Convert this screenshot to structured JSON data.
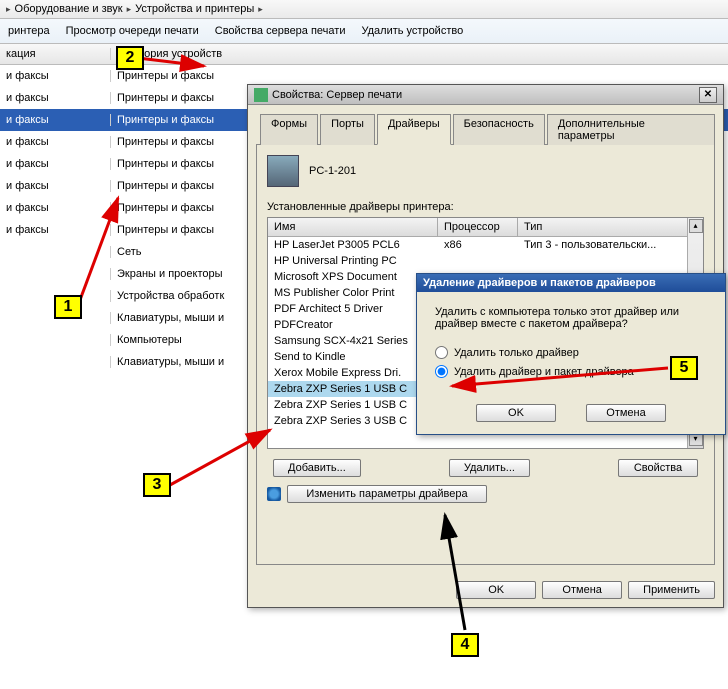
{
  "breadcrumb": {
    "item1": "Оборудование и звук",
    "item2": "Устройства и принтеры"
  },
  "toolbar": {
    "item1": "ринтера",
    "item2": "Просмотр очереди печати",
    "item3": "Свойства сервера печати",
    "item4": "Удалить устройство"
  },
  "columns": {
    "a": "кация",
    "b": "Категория устройств"
  },
  "rows": [
    {
      "a": "и факсы",
      "b": "Принтеры и факсы",
      "sel": false
    },
    {
      "a": "и факсы",
      "b": "Принтеры и факсы",
      "sel": false
    },
    {
      "a": "и факсы",
      "b": "Принтеры и факсы",
      "sel": true
    },
    {
      "a": "и факсы",
      "b": "Принтеры и факсы",
      "sel": false
    },
    {
      "a": "и факсы",
      "b": "Принтеры и факсы",
      "sel": false
    },
    {
      "a": "и факсы",
      "b": "Принтеры и факсы",
      "sel": false
    },
    {
      "a": "и факсы",
      "b": "Принтеры и факсы",
      "sel": false
    },
    {
      "a": "и факсы",
      "b": "Принтеры и факсы",
      "sel": false
    },
    {
      "a": "",
      "b": "Сеть",
      "sel": false
    },
    {
      "a": "",
      "b": "Экраны и проекторы",
      "sel": false
    },
    {
      "a": "",
      "b": "Устройства обработк",
      "sel": false
    },
    {
      "a": "",
      "b": "Клавиатуры, мыши и",
      "sel": false
    },
    {
      "a": "",
      "b": "Компьютеры",
      "sel": false
    },
    {
      "a": "",
      "b": "Клавиатуры, мыши и",
      "sel": false
    }
  ],
  "dlg1": {
    "title": "Свойства: Сервер печати",
    "tabs": [
      "Формы",
      "Порты",
      "Драйверы",
      "Безопасность",
      "Дополнительные параметры"
    ],
    "pc": "PC-1-201",
    "label_installed": "Установленные драйверы принтера:",
    "thead": {
      "name": "Имя",
      "proc": "Процессор",
      "type": "Тип"
    },
    "drivers": [
      {
        "name": "HP LaserJet P3005 PCL6",
        "proc": "x86",
        "type": "Тип 3 - пользовательски...",
        "sel": false
      },
      {
        "name": "HP Universal Printing PC",
        "proc": "",
        "type": "",
        "sel": false
      },
      {
        "name": "Microsoft XPS Document",
        "proc": "",
        "type": "",
        "sel": false
      },
      {
        "name": "MS Publisher Color Print",
        "proc": "",
        "type": "",
        "sel": false
      },
      {
        "name": "PDF Architect 5 Driver",
        "proc": "",
        "type": "",
        "sel": false
      },
      {
        "name": "PDFCreator",
        "proc": "",
        "type": "",
        "sel": false
      },
      {
        "name": "Samsung SCX-4x21 Series",
        "proc": "",
        "type": "",
        "sel": false
      },
      {
        "name": "Send to Kindle",
        "proc": "",
        "type": "",
        "sel": false
      },
      {
        "name": "Xerox Mobile Express Dri.",
        "proc": "",
        "type": "",
        "sel": false
      },
      {
        "name": "Zebra ZXP Series 1 USB C",
        "proc": "",
        "type": "",
        "sel": true
      },
      {
        "name": "Zebra ZXP Series 1 USB C",
        "proc": "",
        "type": "",
        "sel": false
      },
      {
        "name": "Zebra ZXP Series 3 USB C",
        "proc": "",
        "type": "",
        "sel": false
      }
    ],
    "btn_add": "Добавить...",
    "btn_remove": "Удалить...",
    "btn_props": "Свойства",
    "btn_change": "Изменить параметры драйвера",
    "btn_ok": "OK",
    "btn_cancel": "Отмена",
    "btn_apply": "Применить"
  },
  "dlg2": {
    "title": "Удаление драйверов и пакетов драйверов",
    "question": "Удалить с компьютера только этот драйвер или драйвер вместе с пакетом драйвера?",
    "opt1": "Удалить только драйвер",
    "opt2": "Удалить драйвер и пакет драйвера",
    "btn_ok": "OK",
    "btn_cancel": "Отмена"
  },
  "callouts": {
    "1": "1",
    "2": "2",
    "3": "3",
    "4": "4",
    "5": "5"
  }
}
